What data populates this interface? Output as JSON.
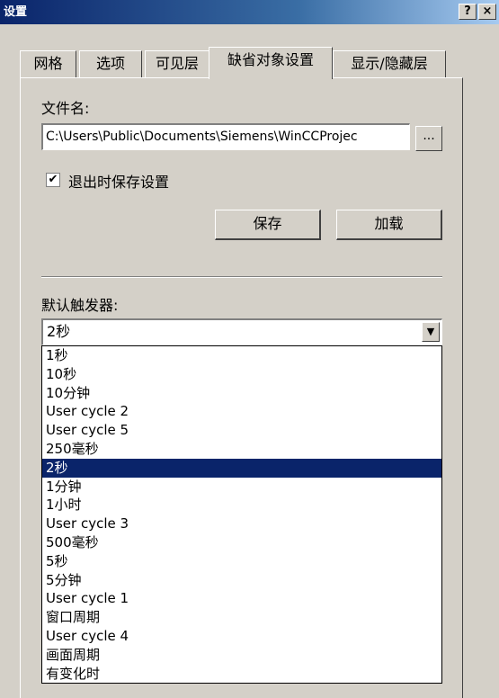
{
  "window": {
    "title": "设置",
    "help_label": "?",
    "close_label": "×"
  },
  "tabs": [
    {
      "label": "网格"
    },
    {
      "label": "选项"
    },
    {
      "label": "可见层"
    },
    {
      "label": "缺省对象设置"
    },
    {
      "label": "显示/隐藏层"
    }
  ],
  "active_tab": "缺省对象设置",
  "settings": {
    "filename_label": "文件名:",
    "filename_value": "C:\\Users\\Public\\Documents\\Siemens\\WinCCProjec",
    "browse_label": "...",
    "save_on_exit_checked": true,
    "save_on_exit_label": "退出时保存设置",
    "save_button": "保存",
    "load_button": "加载",
    "default_trigger_label": "默认触发器:",
    "default_trigger_value": "2秒",
    "trigger_options": [
      "1秒",
      "10秒",
      "10分钟",
      "User cycle 2",
      "User cycle 5",
      "250毫秒",
      "2秒",
      "1分钟",
      "1小时",
      "User cycle 3",
      "500毫秒",
      "5秒",
      "5分钟",
      "User cycle 1",
      "窗口周期",
      "User cycle 4",
      "画面周期",
      "有变化时"
    ]
  },
  "colors": {
    "face": "#d4d0c8",
    "selection": "#0a246a",
    "title_start": "#0a246a"
  }
}
